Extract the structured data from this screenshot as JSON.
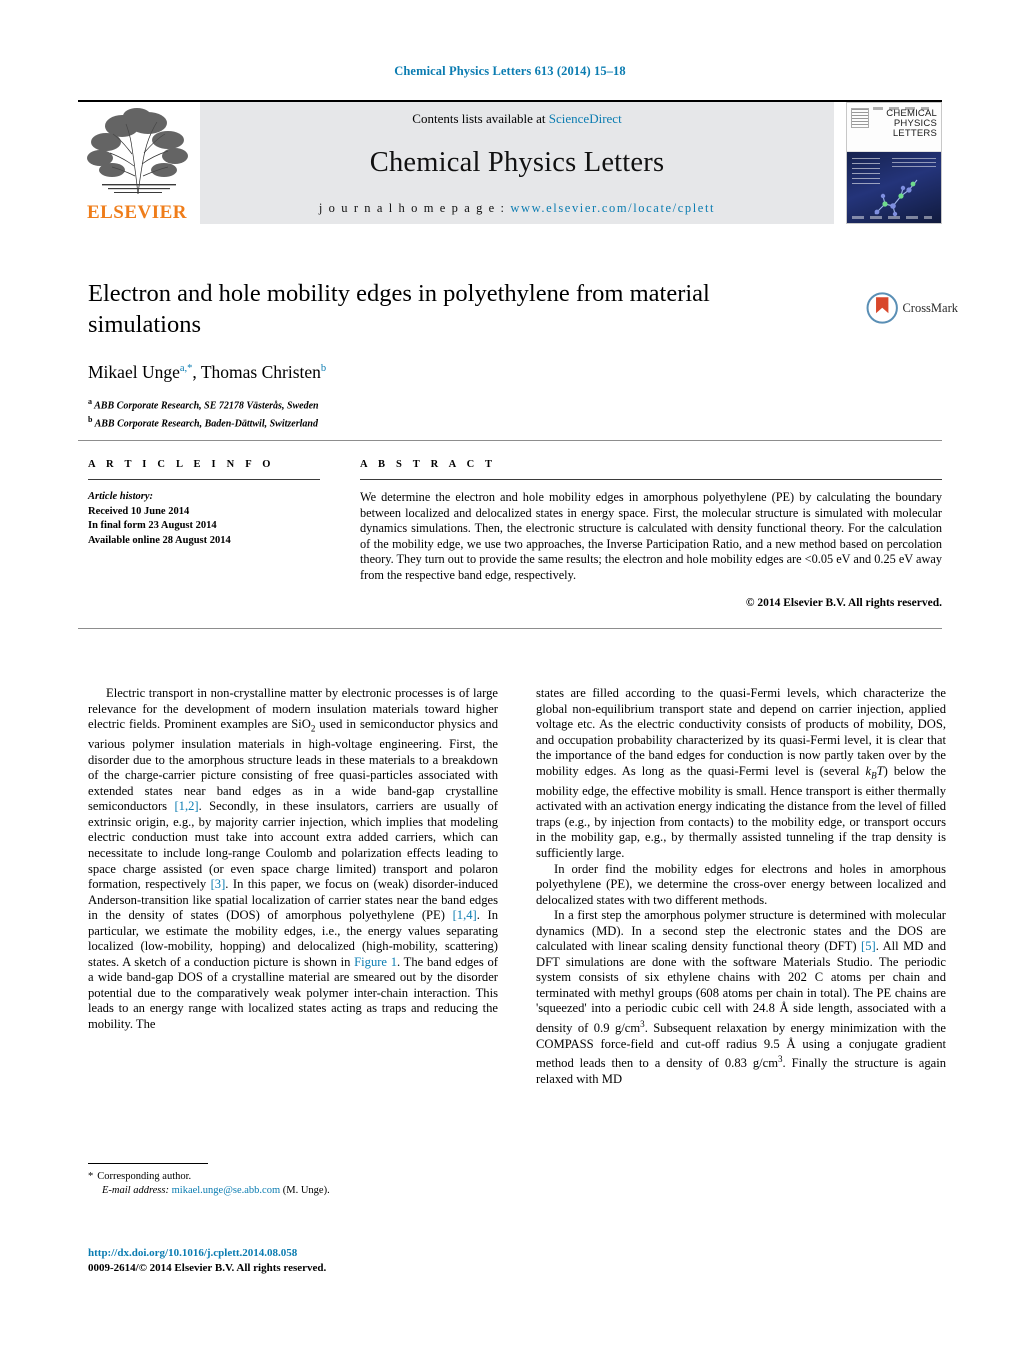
{
  "running_head": "Chemical Physics Letters 613 (2014) 15–18",
  "masthead": {
    "publisher_name": "ELSEVIER",
    "contents_prefix": "Contents lists available at ",
    "contents_link": "ScienceDirect",
    "journal_title": "Chemical Physics Letters",
    "homepage_prefix": "j o u r n a l   h o m e p a g e :  ",
    "homepage_url": "www.elsevier.com/locate/cplett",
    "cover_title_line1": "CHEMICAL",
    "cover_title_line2": "PHYSICS",
    "cover_title_line3": "LETTERS"
  },
  "article": {
    "title": "Electron and hole mobility edges in polyethylene from material simulations",
    "authors_plain": "Mikael Unge",
    "author1": "Mikael Unge",
    "author1_marks": "a,*",
    "author2": "Thomas Christen",
    "author2_marks": "b",
    "affiliation_a_mark": "a",
    "affiliation_a": "ABB Corporate Research, SE 72178 Västerås, Sweden",
    "affiliation_b_mark": "b",
    "affiliation_b": "ABB Corporate Research, Baden-Dättwil, Switzerland",
    "crossmark_label": "CrossMark"
  },
  "article_info": {
    "heading": "A R T I C L E   I N F O",
    "history_label": "Article history:",
    "received": "Received 10 June 2014",
    "final_form": "In final form 23 August 2014",
    "available_online": "Available online 28 August 2014"
  },
  "abstract": {
    "heading": "A B S T R A C T",
    "text": "We determine the electron and hole mobility edges in amorphous polyethylene (PE) by calculating the boundary between localized and delocalized states in energy space. First, the molecular structure is simulated with molecular dynamics simulations. Then, the electronic structure is calculated with density functional theory. For the calculation of the mobility edge, we use two approaches, the Inverse Participation Ratio, and a new method based on percolation theory. They turn out to provide the same results; the electron and hole mobility edges are <0.05 eV and 0.25 eV away from the respective band edge, respectively.",
    "copyright": "© 2014 Elsevier B.V. All rights reserved."
  },
  "body": {
    "left_p1_a": "Electric transport in non-crystalline matter by electronic processes is of large relevance for the development of modern insulation materials toward higher electric fields. Prominent examples are SiO",
    "left_p1_sub": "2",
    "left_p1_b": " used in semiconductor physics and various polymer insulation materials in high-voltage engineering. First, the disorder due to the amorphous structure leads in these materials to a breakdown of the charge-carrier picture consisting of free quasi-particles associated with extended states near band edges as in a wide band-gap crystalline semiconductors ",
    "ref_12": "[1,2]",
    "left_p1_c": ". Secondly, in these insulators, carriers are usually of extrinsic origin, e.g., by majority carrier injection, which implies that modeling electric conduction must take into account extra added carriers, which can necessitate to include long-range Coulomb and polarization effects leading to space charge assisted (or even space charge limited) transport and polaron formation, respectively ",
    "ref_3": "[3]",
    "left_p1_d": ". In this paper, we focus on (weak) disorder-induced Anderson-transition like spatial localization of carrier states near the band edges in the density of states (DOS) of amorphous polyethylene (PE) ",
    "ref_14": "[1,4]",
    "left_p1_e": ". In particular, we estimate the mobility edges, i.e., the energy values separating localized (low-mobility, hopping) and delocalized (high-mobility, scattering) states. A sketch of a conduction picture is shown in ",
    "fig_link": "Figure 1",
    "left_p1_f": ". The band edges of a wide band-gap DOS of a crystalline material are smeared out by the disorder potential due to the comparatively weak polymer inter-chain interaction. This leads to an energy range with localized states acting as traps and reducing the mobility. The",
    "right_p1_a": "states are filled according to the quasi-Fermi levels, which characterize the global non-equilibrium transport state and depend on carrier injection, applied voltage etc. As the electric conductivity consists of products of mobility, DOS, and occupation probability characterized by its quasi-Fermi level, it is clear that the importance of the band edges for conduction is now partly taken over by the mobility edges. As long as the quasi-Fermi level is (several ",
    "right_p1_k": "k",
    "right_p1_b_sub": "B",
    "right_p1_t": "T",
    "right_p1_b": ") below the mobility edge, the effective mobility is small. Hence transport is either thermally activated with an activation energy indicating the distance from the level of filled traps (e.g., by injection from contacts) to the mobility edge, or transport occurs in the mobility gap, e.g., by thermally assisted tunneling if the trap density is sufficiently large.",
    "right_p2": "In order find the mobility edges for electrons and holes in amorphous polyethylene (PE), we determine the cross-over energy between localized and delocalized states with two different methods.",
    "right_p3_a": "In a first step the amorphous polymer structure is determined with molecular dynamics (MD). In a second step the electronic states and the DOS are calculated with linear scaling density functional theory (DFT) ",
    "ref_5": "[5]",
    "right_p3_b": ". All MD and DFT simulations are done with the software Materials Studio. The periodic system consists of six ethylene chains with 202 C atoms per chain and terminated with methyl groups (608 atoms per chain in total). The PE chains are 'squeezed' into a periodic cubic cell with 24.8 Å side length, associated with a density of 0.9 g/cm",
    "right_p3_sup1": "3",
    "right_p3_c": ". Subsequent relaxation by energy minimization with the COMPASS force-field and cut-off radius 9.5 Å using a conjugate gradient method leads then to a density of 0.83 g/cm",
    "right_p3_sup2": "3",
    "right_p3_d": ". Finally the structure is again relaxed with MD"
  },
  "footer": {
    "corresponding_mark": "*",
    "corresponding_label": "Corresponding author.",
    "email_label": "E-mail address:",
    "email": "mikael.unge@se.abb.com",
    "email_suffix": "(M. Unge).",
    "doi": "http://dx.doi.org/10.1016/j.cplett.2014.08.058",
    "issn_line": "0009-2614/© 2014 Elsevier B.V. All rights reserved."
  },
  "colors": {
    "accent_blue": "#0b7cb1",
    "elsevier_orange": "#ef7d1a",
    "band_gray": "#e6e7e9"
  }
}
